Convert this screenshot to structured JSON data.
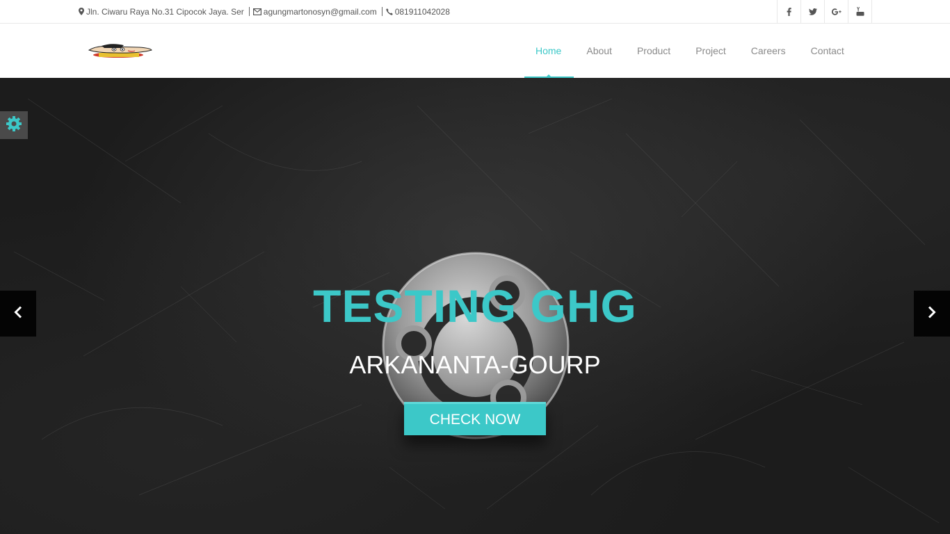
{
  "topbar": {
    "address": "Jln. Ciwaru Raya No.31 Cipocok Jaya. Ser",
    "email": "agungmartonosyn@gmail.com",
    "phone": "081911042028",
    "social": [
      {
        "icon": "facebook-icon",
        "glyph": "f"
      },
      {
        "icon": "twitter-icon",
        "glyph": "t"
      },
      {
        "icon": "google-plus-icon",
        "glyph": "g+"
      },
      {
        "icon": "youtube-icon",
        "glyph": "yt"
      }
    ]
  },
  "header": {
    "nav": [
      {
        "label": "Home",
        "active": true
      },
      {
        "label": "About",
        "active": false
      },
      {
        "label": "Product",
        "active": false
      },
      {
        "label": "Project",
        "active": false
      },
      {
        "label": "Careers",
        "active": false
      },
      {
        "label": "Contact",
        "active": false
      }
    ]
  },
  "hero": {
    "title": "TESTING GHG",
    "subtitle": "ARKANANTA-GOURP",
    "cta_label": "CHECK NOW"
  },
  "colors": {
    "accent": "#3cc8c8",
    "nav_text": "#8a8a8a",
    "hero_bg": "#1c1c1c"
  }
}
